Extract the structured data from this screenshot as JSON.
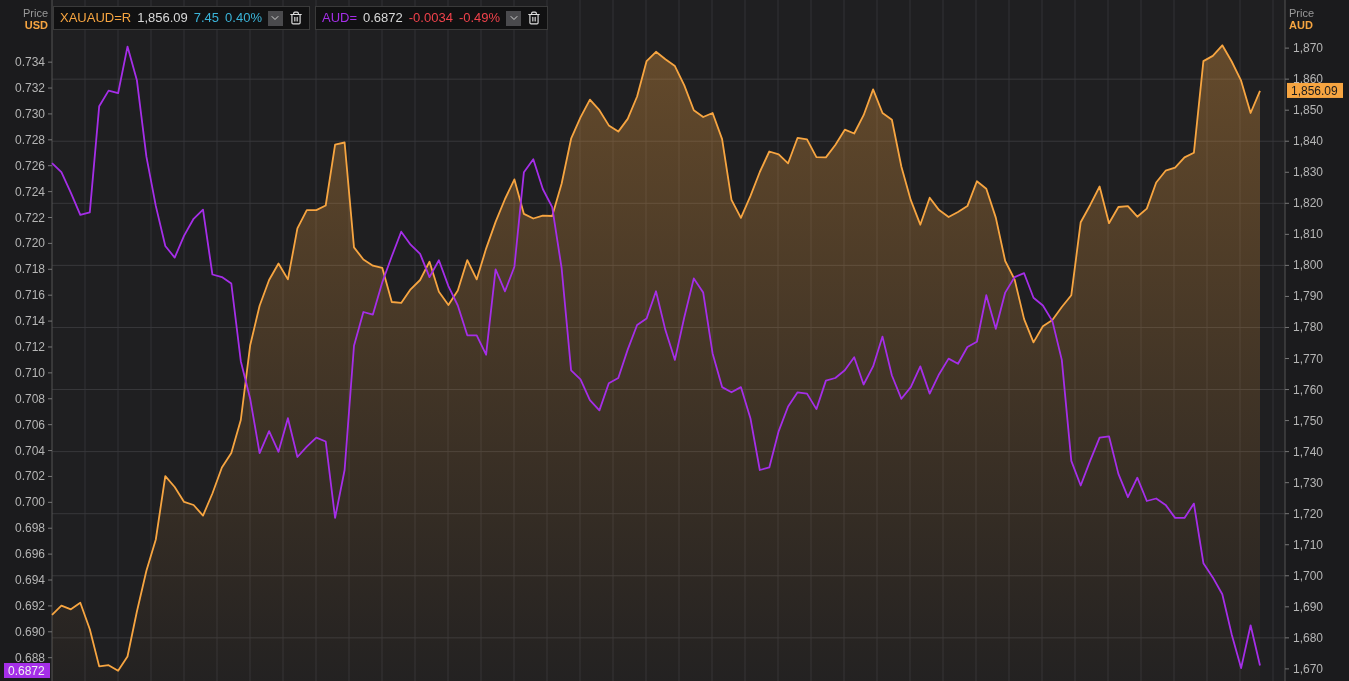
{
  "legend": [
    {
      "last": "1,856.09",
      "change": "7.45",
      "percent": "0.40%",
      "positive": true
    },
    {
      "last": "0.6872",
      "change": "-0.0034",
      "percent": "-0.49%",
      "positive": false
    }
  ],
  "axis_left": {
    "title": "Price",
    "unit": "USD",
    "tag": "0.6872"
  },
  "axis_right": {
    "title": "Price",
    "unit": "AUD",
    "tag": "1,856.09"
  },
  "chart_data": {
    "type": "line",
    "grid": true,
    "ylim": [
      0.6862,
      0.7388
    ],
    "y2lim": [
      1666.1,
      1885.5
    ],
    "categories": [
      null,
      null,
      null,
      null,
      null,
      null,
      null,
      null,
      null,
      null,
      null,
      null,
      null,
      null,
      null,
      null,
      null,
      null,
      null,
      null,
      null,
      null,
      null,
      null,
      null,
      null,
      null,
      null,
      null,
      null,
      null,
      null,
      null,
      null,
      null,
      null,
      null,
      null,
      null,
      null,
      null,
      null,
      null,
      null,
      null,
      null,
      null,
      null,
      null,
      null,
      null,
      null,
      null,
      null,
      null,
      null,
      null,
      null,
      null,
      null,
      null,
      null,
      null,
      null,
      null,
      null,
      null,
      null,
      null,
      null,
      null,
      null,
      null,
      null,
      null,
      null,
      null,
      null,
      null,
      null,
      null,
      null,
      null,
      null,
      null,
      null,
      null,
      null,
      null,
      null,
      null,
      null,
      null,
      null,
      null,
      null,
      null,
      null,
      null,
      null,
      null,
      null,
      null,
      null,
      null,
      null,
      null,
      null,
      null,
      null,
      null,
      null,
      null,
      null,
      null,
      null,
      null,
      null,
      null,
      null,
      null,
      null,
      null,
      null,
      null,
      null,
      null,
      null,
      null
    ],
    "yticks": [
      {
        "value": 0.688,
        "label": "0.688"
      },
      {
        "value": 0.69,
        "label": "0.690"
      },
      {
        "value": 0.692,
        "label": "0.692"
      },
      {
        "value": 0.694,
        "label": "0.694"
      },
      {
        "value": 0.696,
        "label": "0.696"
      },
      {
        "value": 0.698,
        "label": "0.698"
      },
      {
        "value": 0.7,
        "label": "0.700"
      },
      {
        "value": 0.702,
        "label": "0.702"
      },
      {
        "value": 0.704,
        "label": "0.704"
      },
      {
        "value": 0.706,
        "label": "0.706"
      },
      {
        "value": 0.708,
        "label": "0.708"
      },
      {
        "value": 0.71,
        "label": "0.710"
      },
      {
        "value": 0.712,
        "label": "0.712"
      },
      {
        "value": 0.714,
        "label": "0.714"
      },
      {
        "value": 0.716,
        "label": "0.716"
      },
      {
        "value": 0.718,
        "label": "0.718"
      },
      {
        "value": 0.72,
        "label": "0.720"
      },
      {
        "value": 0.722,
        "label": "0.722"
      },
      {
        "value": 0.724,
        "label": "0.724"
      },
      {
        "value": 0.726,
        "label": "0.726"
      },
      {
        "value": 0.728,
        "label": "0.728"
      },
      {
        "value": 0.73,
        "label": "0.730"
      },
      {
        "value": 0.732,
        "label": "0.732"
      },
      {
        "value": 0.734,
        "label": "0.734"
      }
    ],
    "y2ticks": [
      {
        "value": 1670,
        "label": "1,670"
      },
      {
        "value": 1680,
        "label": "1,680"
      },
      {
        "value": 1690,
        "label": "1,690"
      },
      {
        "value": 1700,
        "label": "1,700"
      },
      {
        "value": 1710,
        "label": "1,710"
      },
      {
        "value": 1720,
        "label": "1,720"
      },
      {
        "value": 1730,
        "label": "1,730"
      },
      {
        "value": 1740,
        "label": "1,740"
      },
      {
        "value": 1750,
        "label": "1,750"
      },
      {
        "value": 1760,
        "label": "1,760"
      },
      {
        "value": 1770,
        "label": "1,770"
      },
      {
        "value": 1780,
        "label": "1,780"
      },
      {
        "value": 1790,
        "label": "1,790"
      },
      {
        "value": 1800,
        "label": "1,800"
      },
      {
        "value": 1810,
        "label": "1,810"
      },
      {
        "value": 1820,
        "label": "1,820"
      },
      {
        "value": 1830,
        "label": "1,830"
      },
      {
        "value": 1840,
        "label": "1,840"
      },
      {
        "value": 1850,
        "label": "1,850"
      },
      {
        "value": 1860,
        "label": "1,860"
      },
      {
        "value": 1870,
        "label": "1,870"
      }
    ],
    "series": [
      {
        "name": "XAUAUD=R",
        "color": "#f7a541",
        "type": "area",
        "axis": "y2",
        "values": [
          1687.4,
          1690.4,
          1689.2,
          1691.3,
          1682.8,
          1670.8,
          1671.2,
          1669.4,
          1674.0,
          1688.5,
          1701.6,
          1711.7,
          1732.1,
          1728.6,
          1723.8,
          1722.8,
          1719.4,
          1726.5,
          1734.9,
          1739.6,
          1750.2,
          1774.3,
          1787.0,
          1795.3,
          1800.6,
          1795.5,
          1811.9,
          1817.8,
          1817.8,
          1819.3,
          1838.9,
          1839.6,
          1805.8,
          1801.9,
          1799.9,
          1799.2,
          1788.2,
          1787.9,
          1792.3,
          1795.3,
          1801.2,
          1791.5,
          1787.2,
          1791.9,
          1801.7,
          1795.5,
          1805.4,
          1814.0,
          1821.4,
          1827.7,
          1816.6,
          1815.1,
          1816.0,
          1815.9,
          1826.3,
          1840.8,
          1847.7,
          1853.4,
          1850.0,
          1845.1,
          1843.1,
          1847.2,
          1854.4,
          1865.8,
          1868.8,
          1866.4,
          1864.2,
          1858.0,
          1850.0,
          1847.8,
          1849.1,
          1840.7,
          1821.1,
          1815.3,
          1822.3,
          1830.1,
          1836.7,
          1835.8,
          1832.9,
          1841.1,
          1840.6,
          1834.9,
          1834.8,
          1838.8,
          1843.7,
          1842.5,
          1848.4,
          1856.7,
          1849.1,
          1846.9,
          1831.8,
          1821.0,
          1813.1,
          1821.8,
          1817.8,
          1815.6,
          1817.2,
          1819.1,
          1827.1,
          1824.7,
          1815.4,
          1801.4,
          1795.5,
          1782.7,
          1775.2,
          1780.4,
          1782.4,
          1786.6,
          1790.4,
          1813.9,
          1819.4,
          1825.4,
          1813.6,
          1818.8,
          1819.1,
          1815.7,
          1818.3,
          1826.7,
          1830.5,
          1831.5,
          1834.8,
          1836.3,
          1865.8,
          1867.5,
          1870.9,
          1865.7,
          1859.5,
          1849.1,
          1856.2
        ]
      },
      {
        "name": "AUD=",
        "color": "#a52ee8",
        "values": [
          0.7262,
          0.7255,
          0.7239,
          0.7222,
          0.7224,
          0.7306,
          0.7318,
          0.7316,
          0.7352,
          0.7326,
          0.7267,
          0.7229,
          0.7198,
          0.7189,
          0.7206,
          0.7219,
          0.7226,
          0.7176,
          0.7174,
          0.7169,
          0.7109,
          0.708,
          0.7038,
          0.7055,
          0.7039,
          0.7065,
          0.7035,
          0.7043,
          0.705,
          0.7047,
          0.6988,
          0.7025,
          0.7121,
          0.7147,
          0.7145,
          0.717,
          0.719,
          0.7209,
          0.7199,
          0.7192,
          0.7174,
          0.7187,
          0.7167,
          0.7152,
          0.7129,
          0.7129,
          0.7114,
          0.718,
          0.7163,
          0.7182,
          0.7255,
          0.7265,
          0.7242,
          0.7228,
          0.7181,
          0.7102,
          0.7095,
          0.7079,
          0.7071,
          0.7092,
          0.7096,
          0.7118,
          0.7137,
          0.7142,
          0.7163,
          0.7133,
          0.711,
          0.7143,
          0.7173,
          0.7162,
          0.7115,
          0.7089,
          0.7085,
          0.7089,
          0.7065,
          0.7025,
          0.7027,
          0.7055,
          0.7074,
          0.7085,
          0.7084,
          0.7072,
          0.7094,
          0.7096,
          0.7102,
          0.7112,
          0.7091,
          0.7105,
          0.7128,
          0.7098,
          0.708,
          0.7089,
          0.7105,
          0.7084,
          0.7099,
          0.7111,
          0.7107,
          0.712,
          0.7124,
          0.716,
          0.7134,
          0.7162,
          0.7174,
          0.7177,
          0.7158,
          0.7152,
          0.714,
          0.711,
          0.7032,
          0.7013,
          0.7032,
          0.705,
          0.7051,
          0.7022,
          0.7004,
          0.7019,
          0.7001,
          0.7003,
          0.6998,
          0.6988,
          0.6988,
          0.6999,
          0.6953,
          0.6942,
          0.6929,
          0.6898,
          0.6872,
          0.6905,
          0.6874
        ]
      }
    ]
  }
}
